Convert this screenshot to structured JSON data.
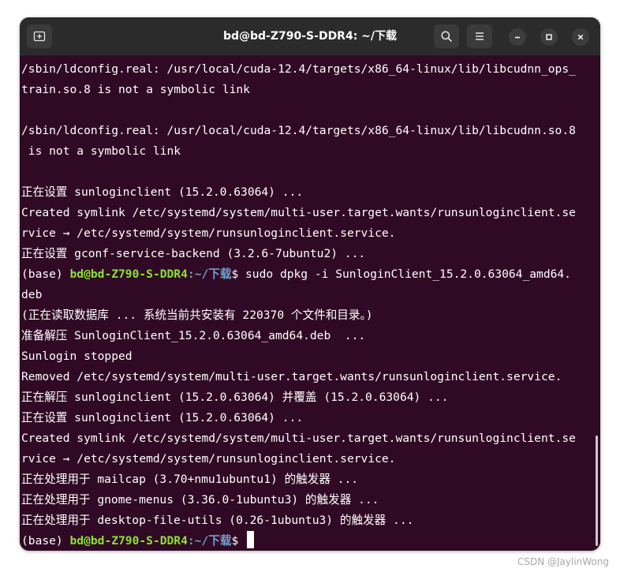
{
  "window": {
    "title": "bd@bd-Z790-S-DDR4: ~/下载"
  },
  "titlebar": {
    "new_tab_icon": "new-tab-icon",
    "search_icon": "search-icon",
    "menu_icon": "hamburger-menu-icon",
    "minimize_icon": "minimize-icon",
    "maximize_icon": "maximize-icon",
    "close_icon": "close-icon"
  },
  "colors": {
    "terminal_bg": "#300a24",
    "prompt_user": "#8ae234",
    "prompt_path": "#729fcf",
    "text": "#ffffff"
  },
  "terminal": {
    "lines": [
      "/sbin/ldconfig.real: /usr/local/cuda-12.4/targets/x86_64-linux/lib/libcudnn_ops_",
      "train.so.8 is not a symbolic link",
      "",
      "/sbin/ldconfig.real: /usr/local/cuda-12.4/targets/x86_64-linux/lib/libcudnn.so.8",
      " is not a symbolic link",
      "",
      "正在设置 sunloginclient (15.2.0.63064) ...",
      "Created symlink /etc/systemd/system/multi-user.target.wants/runsunloginclient.se",
      "rvice → /etc/systemd/system/runsunloginclient.service.",
      "正在设置 gconf-service-backend (3.2.6-7ubuntu2) ..."
    ],
    "prompt1": {
      "prefix": "(base) ",
      "user": "bd@bd-Z790-S-DDR4",
      "path": ":~/下载",
      "dollar": "$ ",
      "command": "sudo dpkg -i SunloginClient_15.2.0.63064_amd64."
    },
    "lines2": [
      "deb",
      "(正在读取数据库 ... 系统当前共安装有 220370 个文件和目录。)",
      "准备解压 SunloginClient_15.2.0.63064_amd64.deb  ...",
      "Sunlogin stopped",
      "Removed /etc/systemd/system/multi-user.target.wants/runsunloginclient.service.",
      "正在解压 sunloginclient (15.2.0.63064) 并覆盖 (15.2.0.63064) ...",
      "正在设置 sunloginclient (15.2.0.63064) ...",
      "Created symlink /etc/systemd/system/multi-user.target.wants/runsunloginclient.se",
      "rvice → /etc/systemd/system/runsunloginclient.service.",
      "正在处理用于 mailcap (3.70+nmu1ubuntu1) 的触发器 ...",
      "正在处理用于 gnome-menus (3.36.0-1ubuntu3) 的触发器 ...",
      "正在处理用于 desktop-file-utils (0.26-1ubuntu3) 的触发器 ..."
    ],
    "prompt2": {
      "prefix": "(base) ",
      "user": "bd@bd-Z790-S-DDR4",
      "path": ":~/下载",
      "dollar": "$ "
    }
  },
  "watermark": "CSDN @JaylinWong"
}
